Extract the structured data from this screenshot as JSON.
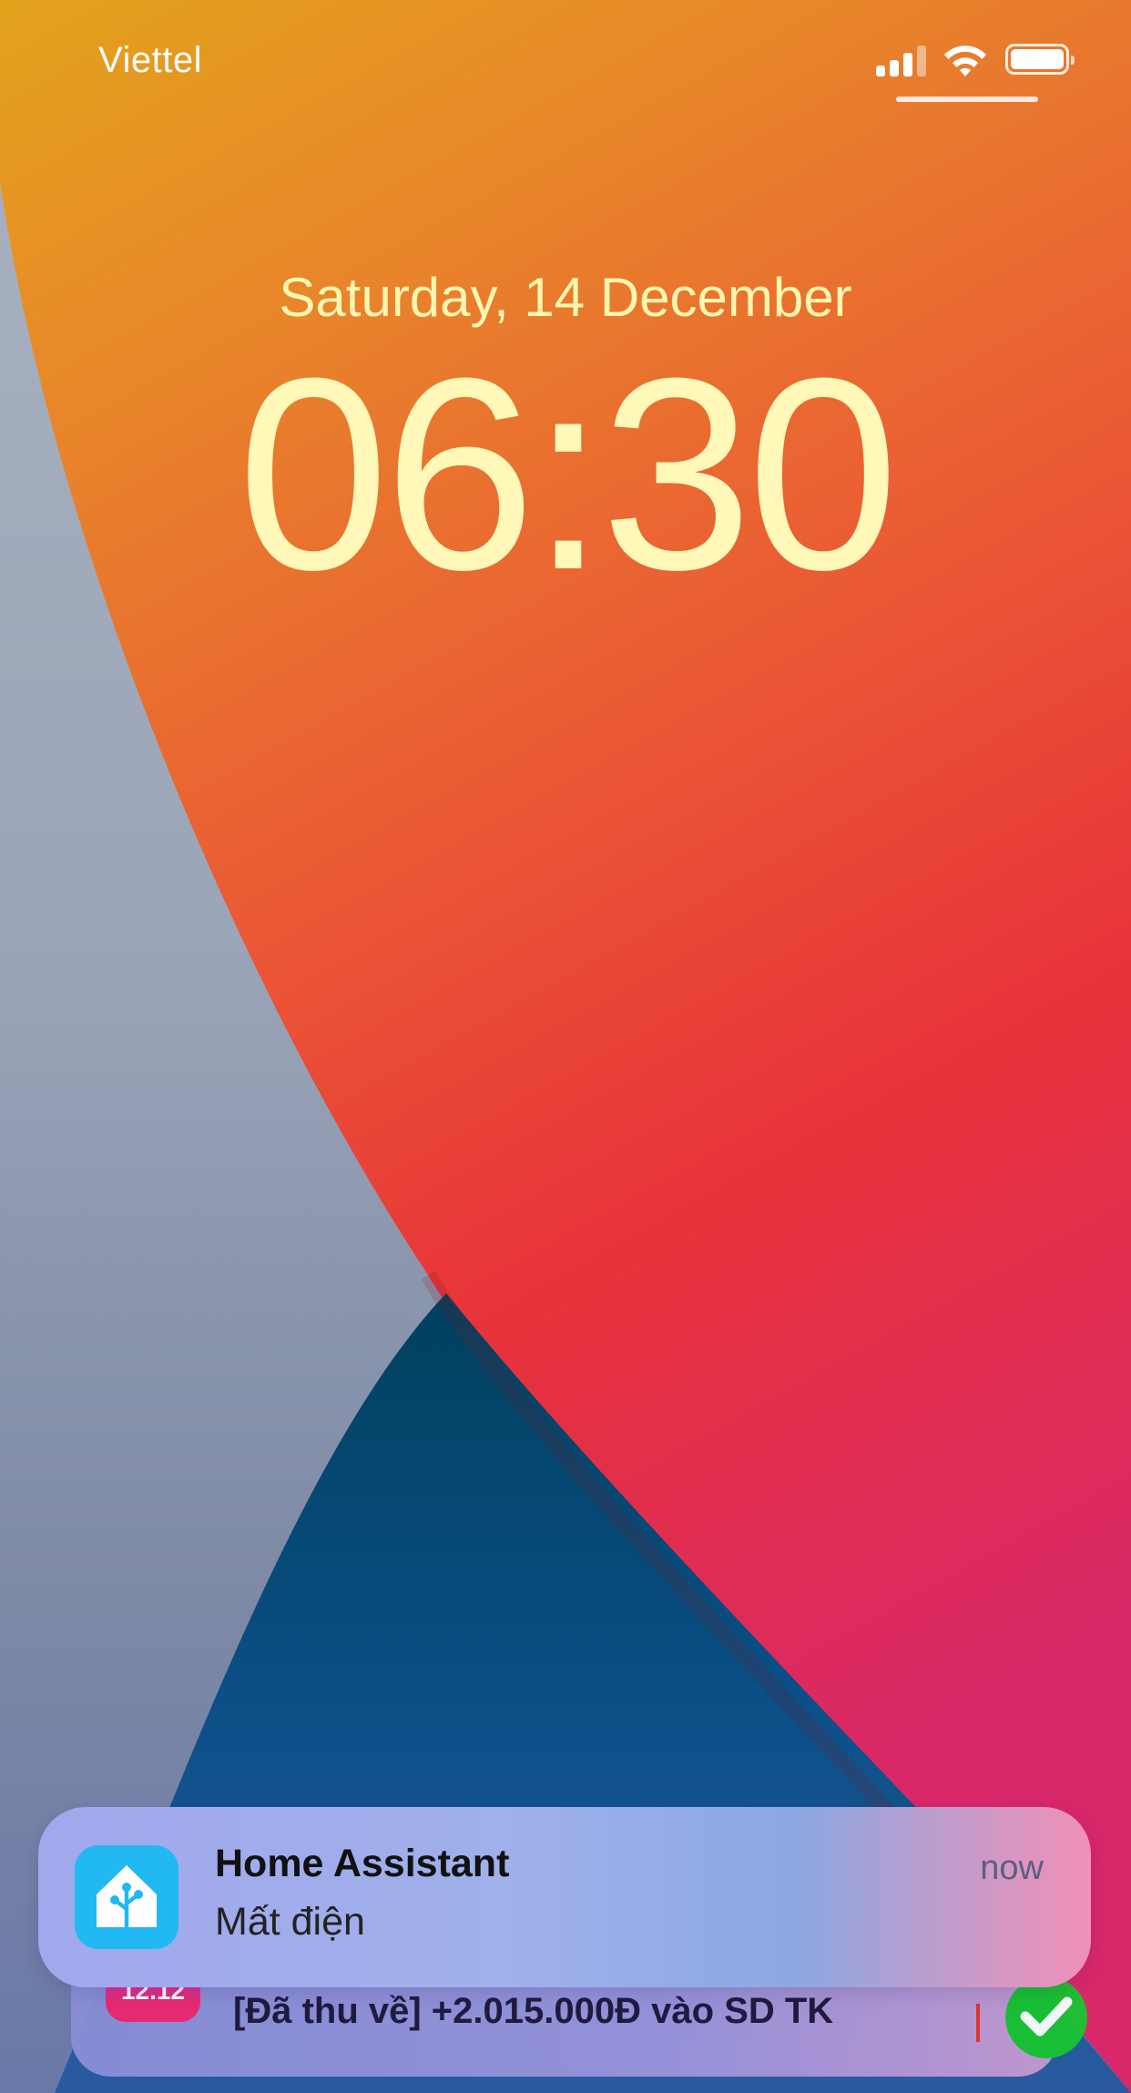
{
  "status_bar": {
    "carrier": "Viettel",
    "signal_icon": "cellular-signal-icon",
    "wifi_icon": "wifi-icon",
    "battery_icon": "battery-icon",
    "battery_level": 1.0
  },
  "lock_screen": {
    "date": "Saturday, 14 December",
    "time": "06:30"
  },
  "notifications": [
    {
      "app": "Home Assistant",
      "message": "Mất điện",
      "time": "now",
      "icon": "home-assistant-icon"
    },
    {
      "icon_label": "12.12",
      "message": "[Đã thu về] +2.015.000Đ vào SD TK",
      "icon": "shopping-app-icon",
      "trailing_icon": "checkmark-icon"
    }
  ],
  "colors": {
    "clock_text": "#fff8b8",
    "home_assistant_brand": "#22b9f2",
    "check_green": "#18c531"
  }
}
